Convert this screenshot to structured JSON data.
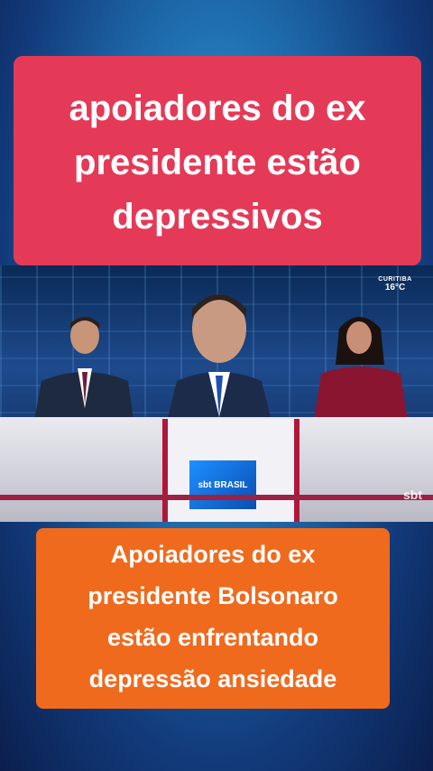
{
  "top_caption": {
    "lines": [
      "apoiadores do ex",
      "presidente estão",
      "depressivos"
    ]
  },
  "video": {
    "weather": {
      "city": "CURITIBA",
      "temp": "16°C"
    },
    "logo": "sbt BRASIL",
    "watermark": "sbt"
  },
  "bottom_caption": {
    "lines": [
      "Apoiadores do ex",
      "presidente Bolsonaro",
      "estão enfrentando",
      "depressão ansiedade"
    ]
  },
  "colors": {
    "top_caption_bg": "#e43a57",
    "bottom_caption_bg": "#f06a1d",
    "desk_stripe": "#b0163b"
  }
}
